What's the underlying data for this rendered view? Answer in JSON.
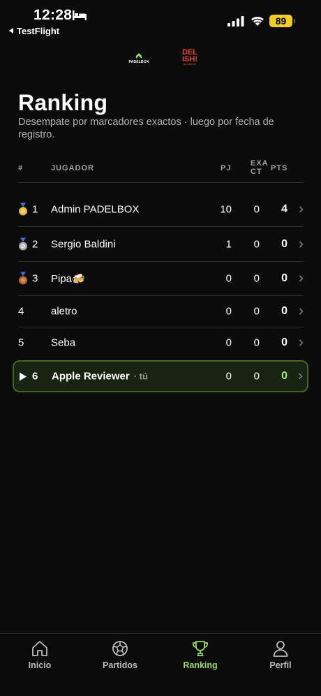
{
  "status_bar": {
    "time": "12:28",
    "back_app": "TestFlight",
    "battery": "89",
    "battery_color": "#f2cf1f"
  },
  "logos": {
    "padelbox": "PADELBOX",
    "delishi": "DEL ISH!",
    "delishi_small": "RECESSO"
  },
  "header": {
    "title": "Ranking",
    "subtitle": "Desempate por marcadores exactos · luego por fecha de registro."
  },
  "table": {
    "columns": {
      "rank": "#",
      "player": "JUGADOR",
      "pj": "PJ",
      "exact_line1": "EXA",
      "exact_line2": "CT",
      "pts": "PTS"
    },
    "rows": [
      {
        "rank": "1",
        "medal": "gold-medal-icon",
        "player": "Admin PADELBOX",
        "pj": "10",
        "exact": "0",
        "pts": "4"
      },
      {
        "rank": "2",
        "medal": "silver-medal-icon",
        "player": "Sergio Baldini",
        "pj": "1",
        "exact": "0",
        "pts": "0"
      },
      {
        "rank": "3",
        "medal": "bronze-medal-icon",
        "player": "Pipa🍻",
        "pj": "0",
        "exact": "0",
        "pts": "0"
      },
      {
        "rank": "4",
        "player": "aletro",
        "pj": "0",
        "exact": "0",
        "pts": "0"
      },
      {
        "rank": "5",
        "player": "Seba",
        "pj": "0",
        "exact": "0",
        "pts": "0"
      }
    ],
    "current_user": {
      "rank": "6",
      "player": "Apple Reviewer",
      "you_label": "· tú",
      "pj": "0",
      "exact": "0",
      "pts": "0"
    }
  },
  "tabs": [
    {
      "label": "Inicio",
      "icon": "home-icon"
    },
    {
      "label": "Partidos",
      "icon": "ball-icon"
    },
    {
      "label": "Ranking",
      "icon": "trophy-icon",
      "active": true
    },
    {
      "label": "Perfil",
      "icon": "user-icon"
    }
  ],
  "colors": {
    "accent": "#98dc5b",
    "highlight_border": "#3f6a1c",
    "highlight_bg": "#182311",
    "background": "#0b0b0b"
  }
}
